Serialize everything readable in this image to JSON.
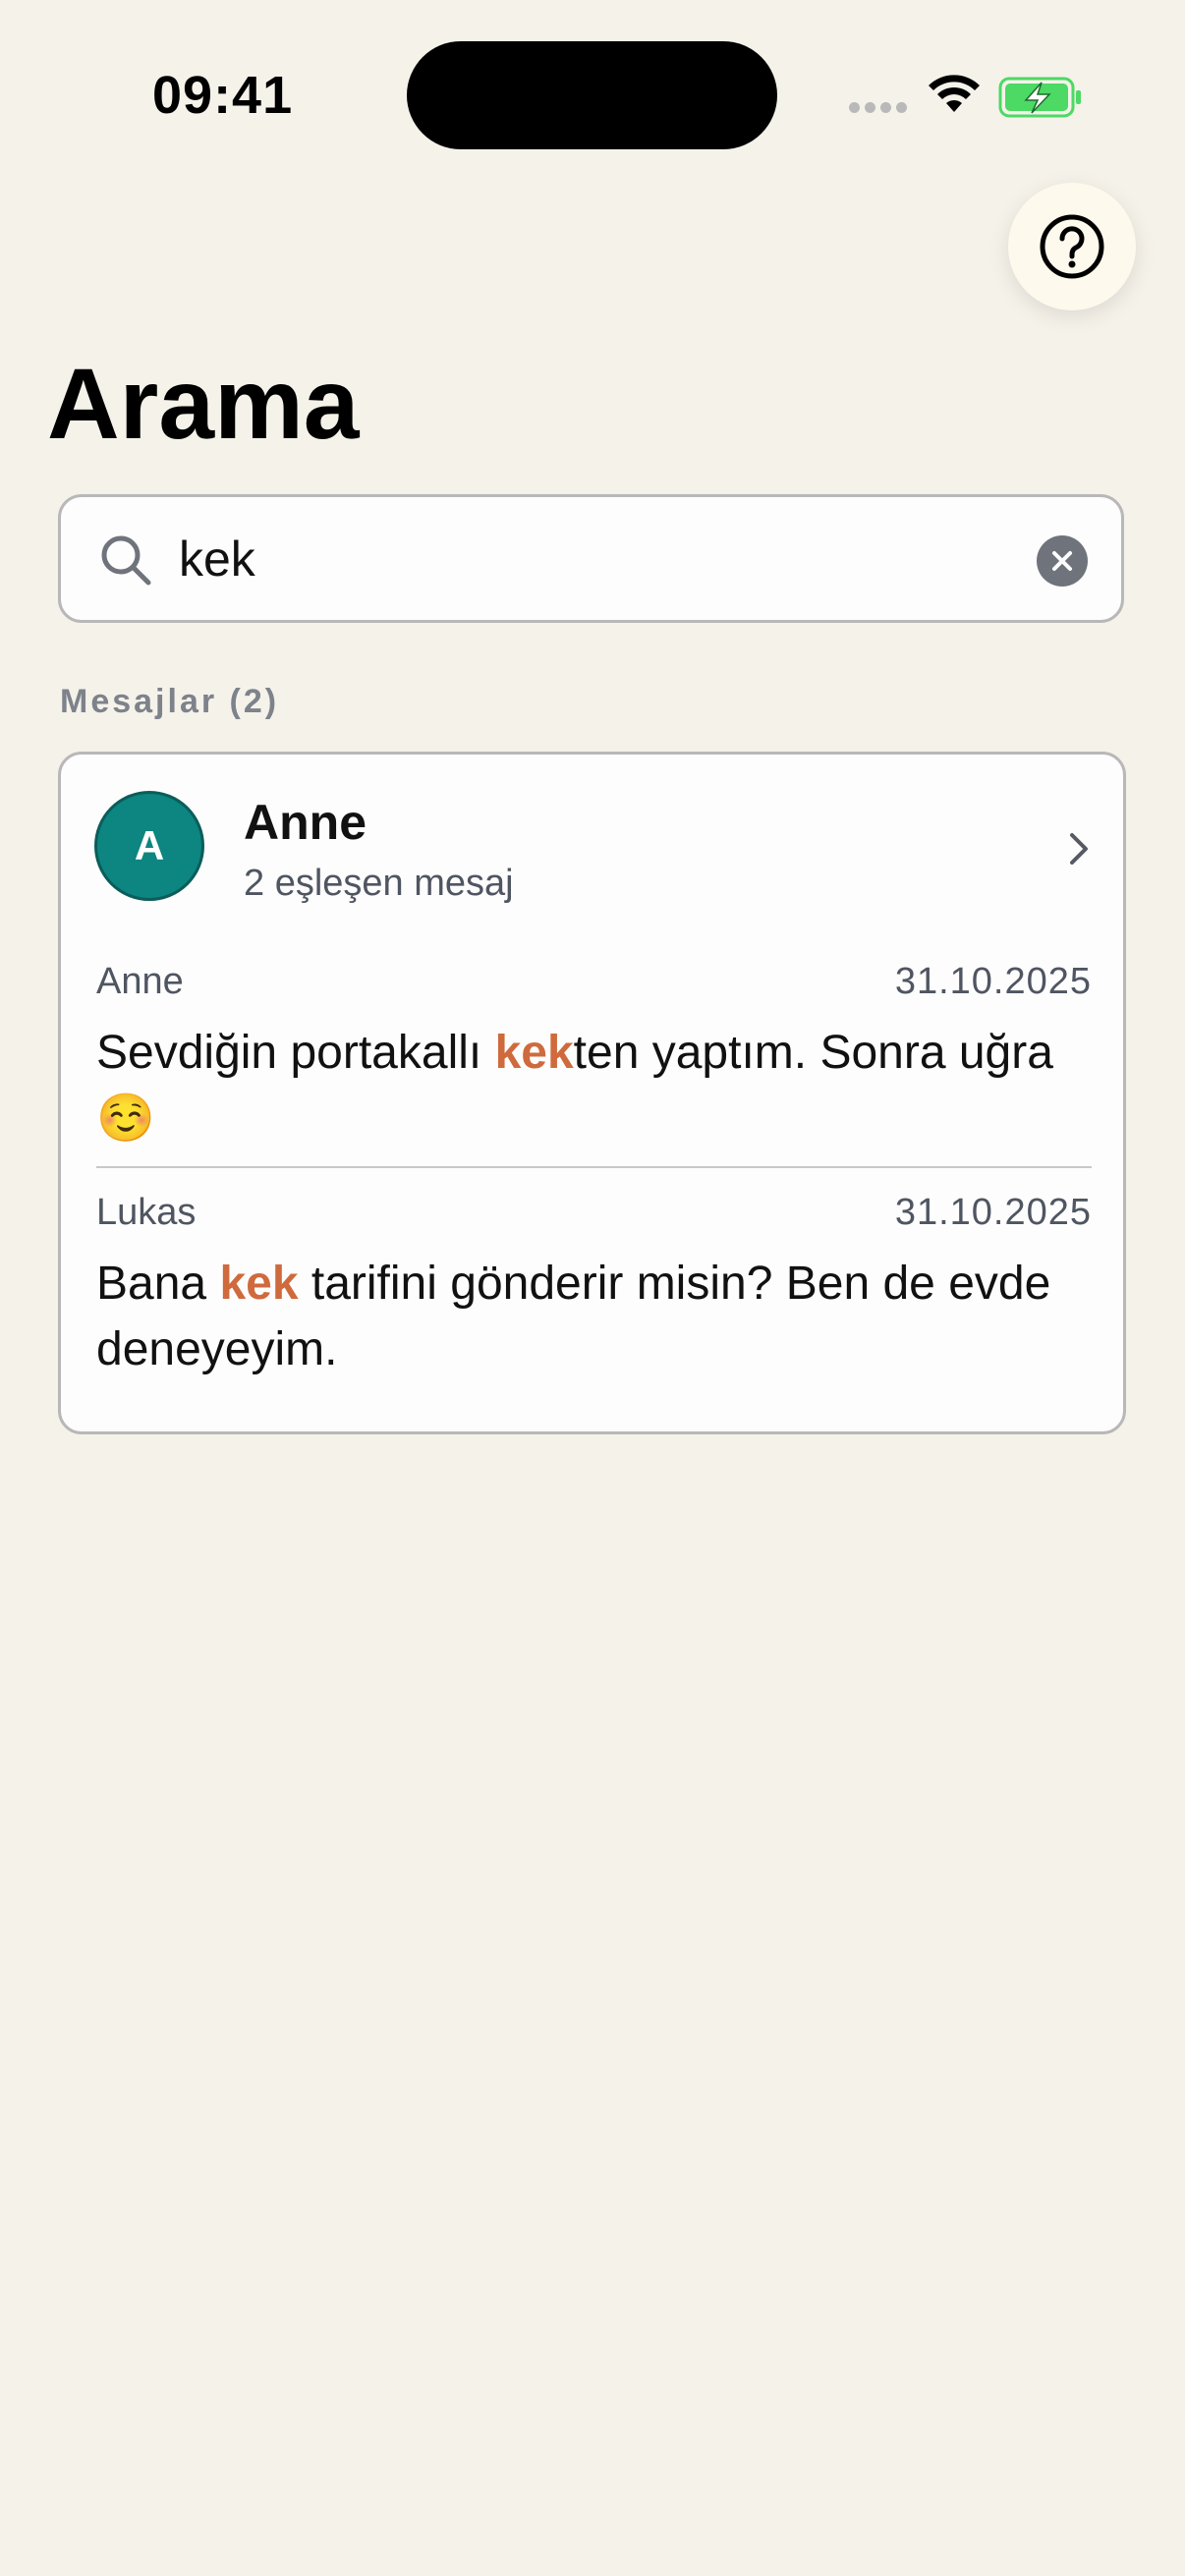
{
  "status_bar": {
    "time": "09:41"
  },
  "header": {
    "help_icon": "question-circle-icon",
    "title": "Arama"
  },
  "search": {
    "value": "kek",
    "placeholder": "",
    "search_icon": "search-icon",
    "clear_icon": "clear-icon"
  },
  "section": {
    "label": "Mesajlar (2)"
  },
  "result": {
    "avatar_letter": "A",
    "avatar_color": "#0d8580",
    "name": "Anne",
    "subtitle": "2 eşleşen mesaj",
    "chevron_icon": "chevron-right-icon",
    "messages": [
      {
        "sender": "Anne",
        "date": "31.10.2025",
        "text_before": "Sevdiğin portakallı ",
        "match": "kek",
        "text_after": "ten yaptım. Sonra uğra ☺️"
      },
      {
        "sender": "Lukas",
        "date": "31.10.2025",
        "text_before": "Bana ",
        "match": "kek",
        "text_after": " tarifini gönderir misin? Ben de evde deneyeyim."
      }
    ]
  },
  "colors": {
    "background": "#f5f2ea",
    "highlight": "#cf6a3d",
    "battery_green": "#4cd964"
  }
}
